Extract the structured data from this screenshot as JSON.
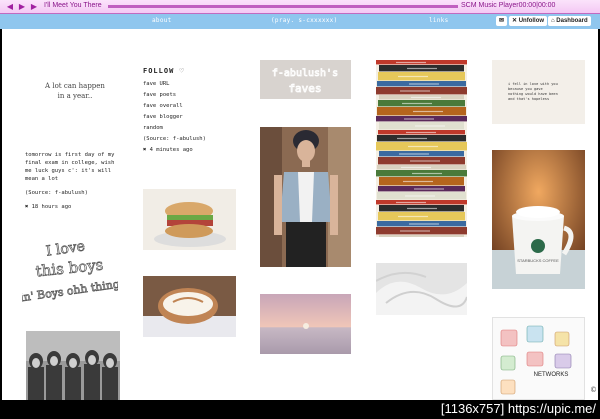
{
  "player": {
    "track_title": "I'll Meet You There",
    "player_name": "SCM Music Player",
    "time_elapsed": "00:00",
    "time_total": "00:00"
  },
  "nav": {
    "about": "about",
    "blog_title": "(pray. s-cxxxxxx)",
    "links": "links",
    "unfollow": "Unfollow",
    "dashboard": "Dashboard"
  },
  "post1": {
    "line1": "A lot can happen",
    "line2": "in a year.."
  },
  "follow": {
    "heading": "FOLLOW",
    "items": [
      "fave URL",
      "fave poets",
      "fave overall",
      "fave blogger",
      "random"
    ],
    "source": "(Source: f-abulush)",
    "time": "4 minutes ago"
  },
  "faves_banner": {
    "line1": "f-abulush's",
    "line2": "faves"
  },
  "post2": {
    "lines": [
      "tomorrow is first day of my",
      "final exam in college, wish",
      "me luck guys c': it's will",
      "mean a lot"
    ],
    "source": "(Source: f-abulush)",
    "time": "18 hours ago"
  },
  "note_card": {
    "lines": [
      "i fell in love with you",
      "because you gave",
      "nothing would have been",
      "and that's hopeless"
    ]
  },
  "handwriting": {
    "lines": [
      "I love",
      "this boys",
      "Bein' Boys ohh things"
    ]
  },
  "mug": {
    "brand": "STARBUCKS COFFEE"
  },
  "sticker": {
    "label": "NETWORKS"
  },
  "footer": {
    "text": "[1136x757] https://upic.me/"
  }
}
